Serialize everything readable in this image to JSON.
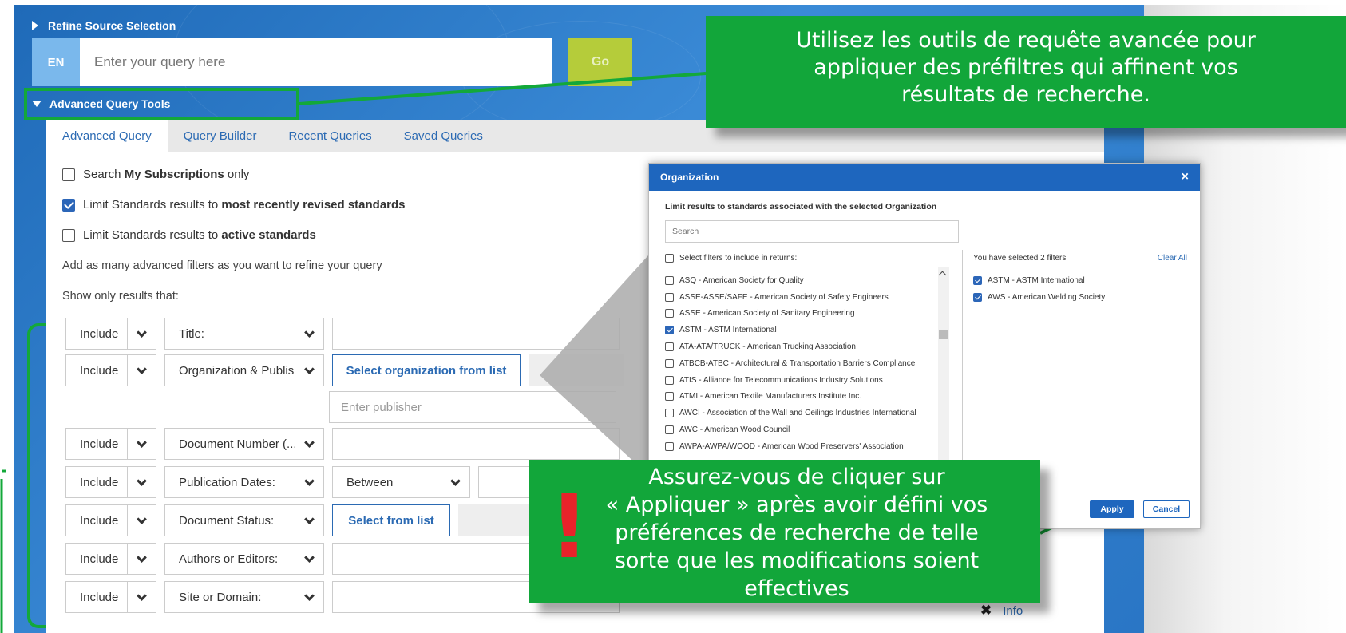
{
  "header": {
    "refine_label": "Refine Source Selection",
    "lang": "EN",
    "query_placeholder": "Enter your query here",
    "go_label": "Go",
    "advanced_tools_label": "Advanced Query Tools"
  },
  "tabs": [
    {
      "label": "Advanced Query",
      "active": true
    },
    {
      "label": "Query Builder",
      "active": false
    },
    {
      "label": "Recent Queries",
      "active": false
    },
    {
      "label": "Saved Queries",
      "active": false
    }
  ],
  "options": {
    "subscriptions": {
      "pre": "Search ",
      "bold": "My Subscriptions",
      "post": " only",
      "checked": false
    },
    "recent": {
      "pre": "Limit Standards results to ",
      "bold": "most recently revised standards",
      "post": "",
      "checked": true
    },
    "active": {
      "pre": "Limit Standards results to ",
      "bold": "active standards",
      "post": "",
      "checked": false
    },
    "add_filters_text": "Add as many advanced filters as you want to refine your query",
    "show_only_text": "Show only results that:"
  },
  "filters": [
    {
      "include": "Include",
      "field": "Title:"
    },
    {
      "include": "Include",
      "field": "Organization & Publis...",
      "button": "Select organization from list",
      "publisher_placeholder": "Enter publisher"
    },
    {
      "include": "Include",
      "field": "Document Number (..."
    },
    {
      "include": "Include",
      "field": "Publication Dates:",
      "range": "Between"
    },
    {
      "include": "Include",
      "field": "Document Status:",
      "button": "Select from list"
    },
    {
      "include": "Include",
      "field": "Authors or Editors:"
    },
    {
      "include": "Include",
      "field": "Site or Domain:"
    }
  ],
  "info_label": "Info",
  "org_dialog": {
    "title": "Organization",
    "close": "×",
    "description": "Limit results to standards associated with the selected Organization",
    "search_placeholder": "Search",
    "left_head": "Select filters to include in returns:",
    "right_head": "You have selected 2 filters",
    "clear_all": "Clear All",
    "items": [
      {
        "label": "ASQ - American Society for Quality",
        "checked": false
      },
      {
        "label": "ASSE-ASSE/SAFE - American Society of Safety Engineers",
        "checked": false
      },
      {
        "label": "ASSE - American Society of Sanitary Engineering",
        "checked": false
      },
      {
        "label": "ASTM - ASTM International",
        "checked": true
      },
      {
        "label": "ATA-ATA/TRUCK - American Trucking Association",
        "checked": false
      },
      {
        "label": "ATBCB-ATBC - Architectural & Transportation Barriers Compliance",
        "checked": false
      },
      {
        "label": "ATIS - Alliance for Telecommunications Industry Solutions",
        "checked": false
      },
      {
        "label": "ATMI - American Textile Manufacturers Institute Inc.",
        "checked": false
      },
      {
        "label": "AWCI - Association of the Wall and Ceilings Industries International",
        "checked": false
      },
      {
        "label": "AWC - American Wood Council",
        "checked": false
      },
      {
        "label": "AWPA-AWPA/WOOD - American Wood Preservers' Association",
        "checked": false
      }
    ],
    "selected": [
      {
        "label": "ASTM - ASTM International",
        "checked": true
      },
      {
        "label": "AWS - American Welding Society",
        "checked": true
      }
    ],
    "apply_label": "Apply",
    "cancel_label": "Cancel"
  },
  "callouts": {
    "top": [
      "Utilisez les outils de requête avancée pour",
      "appliquer des préfiltres qui affinent vos",
      "résultats de recherche."
    ],
    "bottom": [
      "Assurez-vous de cliquer sur",
      "« Appliquer » après avoir défini vos",
      "préférences de recherche de telle",
      "sorte que les modifications soient",
      "effectives"
    ],
    "exclaim": "!"
  },
  "colors": {
    "brand_blue": "#2a77c7",
    "callout_green": "#12a63a",
    "accent_yellow_green": "#b5cc3a",
    "alert_red": "#e8232a"
  }
}
